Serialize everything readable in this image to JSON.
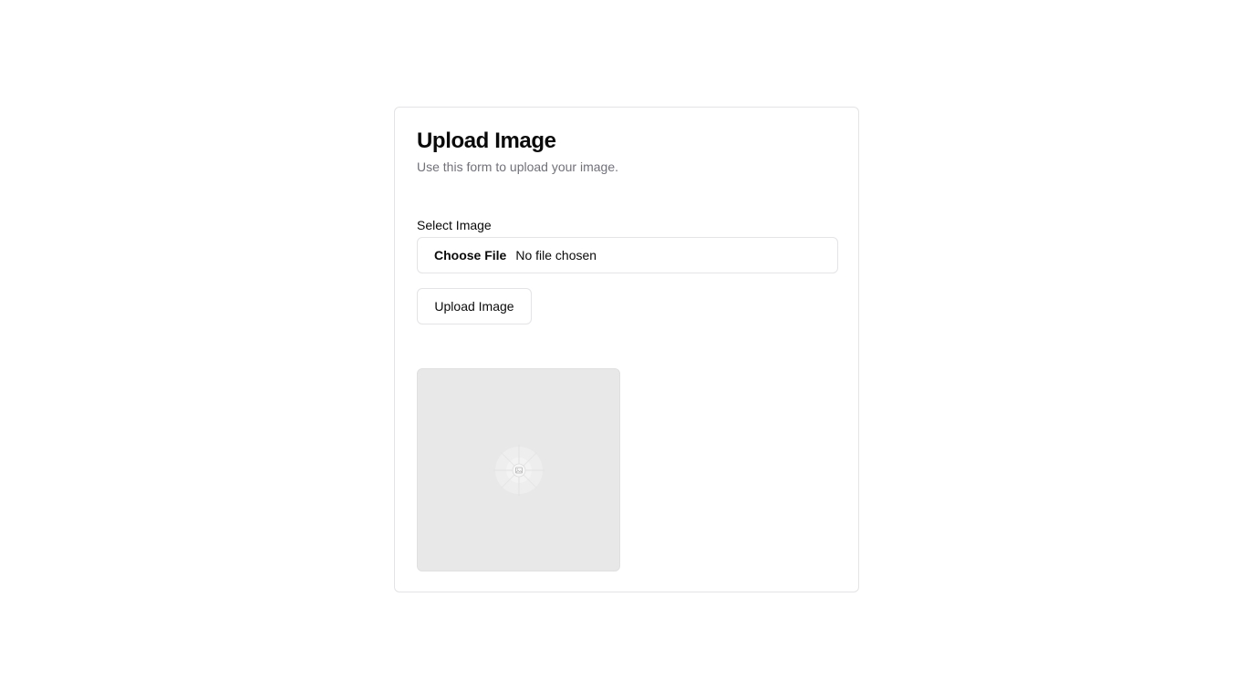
{
  "card": {
    "title": "Upload Image",
    "description": "Use this form to upload your image."
  },
  "form": {
    "field_label": "Select Image",
    "file_button_label": "Choose File",
    "file_status": "No file chosen",
    "submit_label": "Upload Image"
  },
  "preview": {
    "icon": "image-placeholder-icon"
  },
  "colors": {
    "border": "#e4e4e7",
    "muted_text": "#71717a",
    "preview_bg": "#e8e8e8"
  }
}
